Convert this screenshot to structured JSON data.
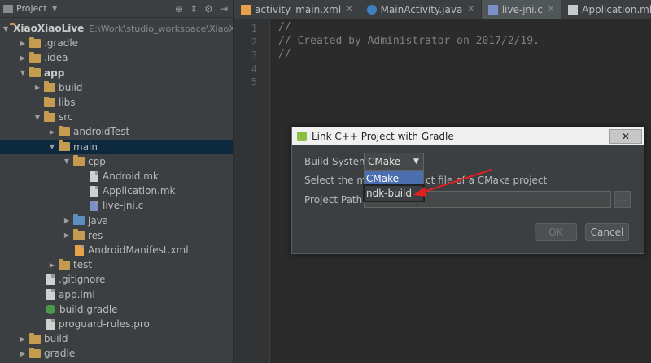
{
  "project_panel": {
    "title": "Project",
    "toolbar_icons": [
      "target-icon",
      "split-icon",
      "gear-icon",
      "hide-icon"
    ],
    "tree": [
      {
        "label": "XiaoXiaoLive",
        "path": "E:\\Work\\studio_workspace\\XiaoXi",
        "indent": 0,
        "arrow": "▼",
        "icon": "folder",
        "bold": true
      },
      {
        "label": ".gradle",
        "indent": 1,
        "arrow": "▶",
        "icon": "folder"
      },
      {
        "label": ".idea",
        "indent": 1,
        "arrow": "▶",
        "icon": "folder"
      },
      {
        "label": "app",
        "indent": 1,
        "arrow": "▼",
        "icon": "folder",
        "bold": true
      },
      {
        "label": "build",
        "indent": 2,
        "arrow": "▶",
        "icon": "folder"
      },
      {
        "label": "libs",
        "indent": 2,
        "arrow": "",
        "icon": "folder"
      },
      {
        "label": "src",
        "indent": 2,
        "arrow": "▼",
        "icon": "folder"
      },
      {
        "label": "androidTest",
        "indent": 3,
        "arrow": "▶",
        "icon": "folder"
      },
      {
        "label": "main",
        "indent": 3,
        "arrow": "▼",
        "icon": "folder",
        "selected": true
      },
      {
        "label": "cpp",
        "indent": 4,
        "arrow": "▼",
        "icon": "folder"
      },
      {
        "label": "Android.mk",
        "indent": 5,
        "arrow": "",
        "icon": "file"
      },
      {
        "label": "Application.mk",
        "indent": 5,
        "arrow": "",
        "icon": "file"
      },
      {
        "label": "live-jni.c",
        "indent": 5,
        "arrow": "",
        "icon": "file-c"
      },
      {
        "label": "java",
        "indent": 4,
        "arrow": "▶",
        "icon": "folder-blue"
      },
      {
        "label": "res",
        "indent": 4,
        "arrow": "▶",
        "icon": "folder"
      },
      {
        "label": "AndroidManifest.xml",
        "indent": 4,
        "arrow": "",
        "icon": "file-xml"
      },
      {
        "label": "test",
        "indent": 3,
        "arrow": "▶",
        "icon": "folder"
      },
      {
        "label": ".gitignore",
        "indent": 2,
        "arrow": "",
        "icon": "file"
      },
      {
        "label": "app.iml",
        "indent": 2,
        "arrow": "",
        "icon": "file"
      },
      {
        "label": "build.gradle",
        "indent": 2,
        "arrow": "",
        "icon": "file-gradle"
      },
      {
        "label": "proguard-rules.pro",
        "indent": 2,
        "arrow": "",
        "icon": "file"
      },
      {
        "label": "build",
        "indent": 1,
        "arrow": "▶",
        "icon": "folder"
      },
      {
        "label": "gradle",
        "indent": 1,
        "arrow": "▶",
        "icon": "folder"
      }
    ]
  },
  "editor": {
    "tabs": [
      {
        "label": "activity_main.xml",
        "icon": "xml"
      },
      {
        "label": "MainActivity.java",
        "icon": "java"
      },
      {
        "label": "live-jni.c",
        "icon": "c",
        "active": true
      },
      {
        "label": "Application.mk",
        "icon": "mk"
      }
    ],
    "line_numbers": [
      "1",
      "2",
      "3",
      "4",
      "5"
    ],
    "code_lines": [
      "//",
      "// Created by Administrator on 2017/2/19.",
      "//",
      "",
      ""
    ]
  },
  "dialog": {
    "title": "Link C++ Project with Gradle",
    "close_label": "✕",
    "build_system_label": "Build System",
    "build_system_value": "CMake",
    "dropdown_options": [
      {
        "label": "CMake",
        "state": "selected"
      },
      {
        "label": "ndk-build",
        "state": "hovered"
      }
    ],
    "description_prefix": "Select the mai",
    "description_suffix": "ct file of a CMake project",
    "project_path_label": "Project Path",
    "project_path_value": "",
    "browse_label": "...",
    "ok_label": "OK",
    "cancel_label": "Cancel"
  },
  "colors": {
    "annotation_arrow": "#e02020",
    "selection_blue": "#4b6eaf"
  }
}
